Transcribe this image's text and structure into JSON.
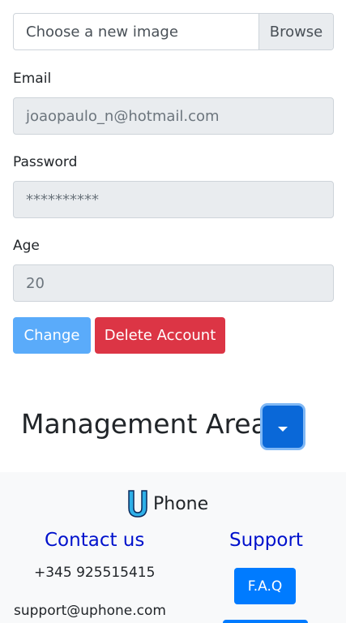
{
  "file_picker": {
    "placeholder": "Choose a new image",
    "browse_label": "Browse"
  },
  "fields": {
    "email": {
      "label": "Email",
      "value": "joaopaulo_n@hotmail.com"
    },
    "password": {
      "label": "Password",
      "value": "**********"
    },
    "age": {
      "label": "Age",
      "value": "20"
    }
  },
  "actions": {
    "change_label": "Change",
    "delete_label": "Delete Account"
  },
  "management": {
    "title": "Management Area",
    "toggle_icon": "caret-down-icon"
  },
  "footer": {
    "brand_letter_icon": "u-logo-icon",
    "brand_text": "Phone",
    "contact": {
      "heading": "Contact us",
      "phone": "+345 925515415",
      "email": "support@uphone.com"
    },
    "support": {
      "heading": "Support",
      "faq_label": "F.A.Q"
    }
  },
  "colors": {
    "primary": "#007bff",
    "primary_light": "#5aabfa",
    "danger": "#dc3545",
    "heading_blue": "#0011cc",
    "footer_bg": "#f8f9fa",
    "readonly_bg": "#e9ecef"
  }
}
